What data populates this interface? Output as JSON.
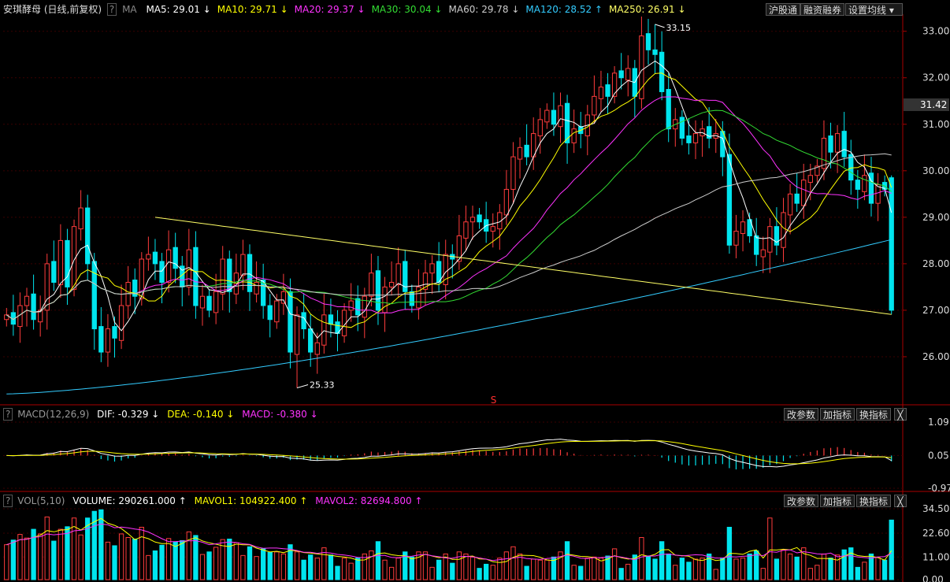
{
  "stock": {
    "name": "安琪酵母",
    "mode": "(日线,前复权)",
    "help": "?",
    "ma_label": "MA"
  },
  "ma_items": [
    {
      "label": "MA5: 29.01",
      "arrow": "↓",
      "color": "#ffffff"
    },
    {
      "label": "MA10: 29.71",
      "arrow": "↓",
      "color": "#ffff00"
    },
    {
      "label": "MA20: 29.37",
      "arrow": "↓",
      "color": "#ff33ff"
    },
    {
      "label": "MA30: 30.04",
      "arrow": "↓",
      "color": "#33dd33"
    },
    {
      "label": "MA60: 29.78",
      "arrow": "↓",
      "color": "#cccccc"
    },
    {
      "label": "MA120: 28.52",
      "arrow": "↑",
      "color": "#33ccff"
    },
    {
      "label": "MA250: 26.91",
      "arrow": "↓",
      "color": "#ffff66"
    }
  ],
  "toolbar": {
    "hgt": "沪股通",
    "margin": "融资融券",
    "set_ma": "设置均线",
    "dropdown": "▾"
  },
  "price_axis": {
    "ticks": [
      "33.00",
      "32.00",
      "31.00",
      "30.00",
      "29.00",
      "28.00",
      "27.00",
      "26.00"
    ],
    "current": "31.42"
  },
  "annotations": {
    "high": "33.15",
    "low": "25.33",
    "marker": "S"
  },
  "macd": {
    "help": "?",
    "title": "MACD(12,26,9)",
    "dif": "DIF: -0.329",
    "dif_arrow": "↓",
    "dea": "DEA: -0.140",
    "dea_arrow": "↓",
    "macd": "MACD: -0.380",
    "macd_arrow": "↓",
    "ticks": [
      "1.09",
      "0.05",
      "-0.97"
    ]
  },
  "vol": {
    "help": "?",
    "title": "VOL(5,10)",
    "volume": "VOLUME: 290261.000",
    "volume_arrow": "↑",
    "mavol1": "MAVOL1: 104922.400",
    "mavol1_arrow": "↑",
    "mavol2": "MAVOL2: 82694.800",
    "mavol2_arrow": "↑",
    "ticks": [
      "34.50",
      "22.60",
      "11.00",
      "0.00"
    ]
  },
  "panel_buttons": {
    "params": "改参数",
    "add": "加指标",
    "switch": "换指标",
    "close": "╳"
  },
  "colors": {
    "up": "#ff3c3c",
    "down": "#00e5ee",
    "bg": "#000000",
    "grid": "#3a0000"
  },
  "chart_data": {
    "type": "candlestick",
    "y_range": [
      25.0,
      33.3
    ],
    "closes": [
      26.9,
      26.7,
      27.1,
      27.3,
      26.8,
      27.0,
      28.0,
      27.6,
      28.5,
      27.5,
      28.8,
      29.2,
      28.0,
      26.6,
      26.1,
      26.6,
      26.4,
      27.1,
      27.6,
      27.3,
      28.1,
      28.2,
      28.0,
      27.6,
      28.3,
      27.9,
      27.5,
      28.3,
      27.1,
      27.3,
      27.0,
      27.4,
      28.1,
      27.4,
      27.8,
      28.2,
      27.4,
      27.6,
      27.1,
      26.8,
      27.2,
      27.4,
      26.1,
      26.9,
      26.6,
      26.1,
      26.3,
      26.9,
      26.7,
      26.5,
      27.0,
      27.2,
      26.9,
      27.3,
      27.8,
      27.0,
      27.5,
      27.6,
      28.0,
      27.4,
      27.1,
      27.5,
      27.8,
      28.0,
      27.6,
      28.2,
      28.1,
      28.6,
      28.9,
      29.0,
      28.9,
      28.7,
      28.8,
      29.1,
      29.6,
      30.3,
      30.5,
      30.3,
      30.8,
      31.1,
      31.3,
      31.0,
      31.4,
      30.6,
      30.9,
      30.8,
      31.2,
      31.6,
      31.8,
      31.6,
      32.1,
      32.0,
      32.2,
      31.6,
      32.9,
      32.6,
      32.5,
      31.7,
      30.9,
      31.1,
      30.7,
      30.6,
      30.8,
      30.9,
      30.7,
      30.8,
      30.3,
      28.4,
      28.7,
      28.9,
      28.6,
      28.2,
      28.3,
      28.8,
      28.4,
      29.1,
      29.5,
      29.3,
      29.8,
      29.9,
      30.1,
      30.7,
      30.4,
      30.8,
      30.3,
      29.8,
      29.6,
      29.9,
      29.3,
      29.7,
      29.6,
      27.0
    ],
    "high_label": 33.15,
    "low_label": 25.33,
    "ma": {
      "ma5": 29.01,
      "ma10": 29.71,
      "ma20": 29.37,
      "ma30": 30.04,
      "ma60": 29.78,
      "ma120": 28.52,
      "ma250": 26.91
    },
    "macd_range": [
      -0.97,
      1.09
    ],
    "macd_last": {
      "dif": -0.329,
      "dea": -0.14,
      "macd": -0.38
    },
    "vol_range": [
      0,
      34.5
    ],
    "vol_last": {
      "volume": 290261.0,
      "mavol1": 104922.4,
      "mavol2": 82694.8
    }
  }
}
